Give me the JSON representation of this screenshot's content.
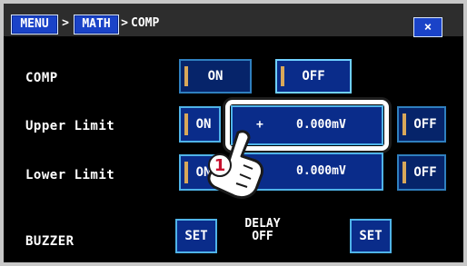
{
  "breadcrumb": {
    "menu": "MENU",
    "sep1": ">",
    "math": "MATH",
    "sep2": ">",
    "current": "COMP"
  },
  "close": "×",
  "rows": {
    "comp": {
      "label": "COMP",
      "on": "ON",
      "off": "OFF"
    },
    "upper": {
      "label": "Upper Limit",
      "on": "ON",
      "sign": "+",
      "value": "0.000mV",
      "off": "OFF"
    },
    "lower": {
      "label": "Lower Limit",
      "on": "ON",
      "sign": "+",
      "value": "0.000mV",
      "off": "OFF"
    },
    "buzzer": {
      "label": "BUZZER",
      "set1": "SET",
      "delay_line1": "DELAY",
      "delay_line2": "OFF",
      "set2": "SET"
    }
  },
  "step_badge": "1",
  "colors": {
    "button_fill": "#0a2c8a",
    "button_border": "#4fb3e8",
    "header_button": "#1a43c8",
    "screen_bg": "#000000"
  }
}
